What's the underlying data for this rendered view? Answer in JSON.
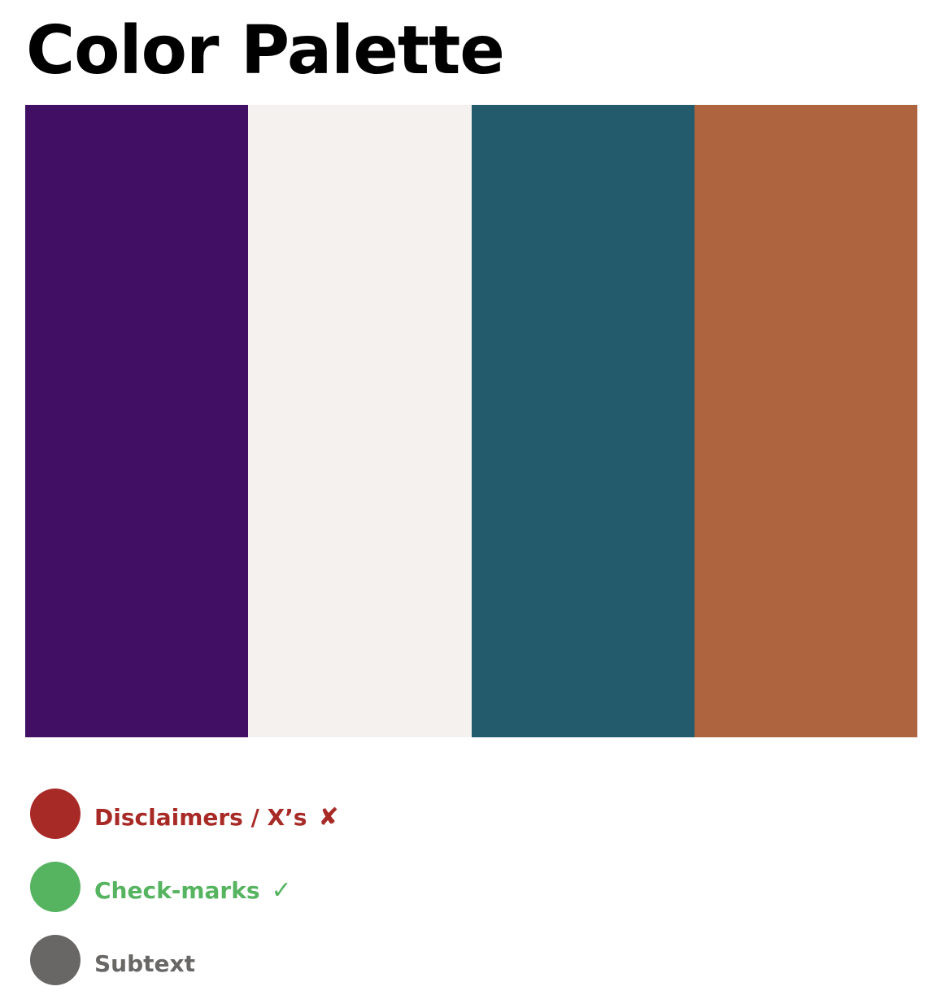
{
  "title": "Color Palette",
  "palette": [
    {
      "color": "#410f64"
    },
    {
      "color": "#f5f1ee"
    },
    {
      "color": "#245b6c"
    },
    {
      "color": "#ad643f"
    }
  ],
  "legend": [
    {
      "label": "Disclaimers / X’s",
      "color": "#a82a27",
      "icon": "cross-mark-icon",
      "glyph": "✘"
    },
    {
      "label": "Check-marks",
      "color": "#56b461",
      "icon": "check-mark-icon",
      "glyph": "✓"
    },
    {
      "label": "Subtext",
      "color": "#686766"
    }
  ]
}
